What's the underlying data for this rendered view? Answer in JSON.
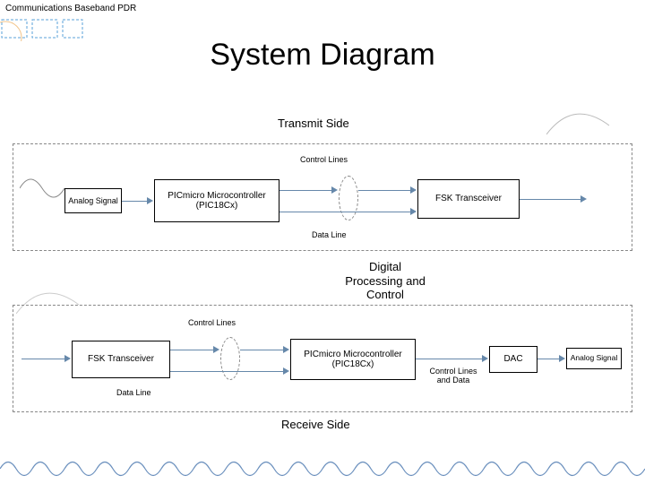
{
  "header": "Communications Baseband PDR",
  "title": "System Diagram",
  "transmit": {
    "section": "Transmit Side",
    "analog": "Analog Signal",
    "pic": "PICmicro Microcontroller (PIC18Cx)",
    "control": "Control Lines",
    "data": "Data Line",
    "fsk": "FSK Transceiver"
  },
  "center": "Digital Processing and Control",
  "receive": {
    "section": "Receive Side",
    "fsk": "FSK Transceiver",
    "control": "Control Lines",
    "data": "Data Line",
    "pic": "PICmicro Microcontroller (PIC18Cx)",
    "controlData": "Control Lines and Data",
    "dac": "DAC",
    "analog": "Analog Signal"
  }
}
